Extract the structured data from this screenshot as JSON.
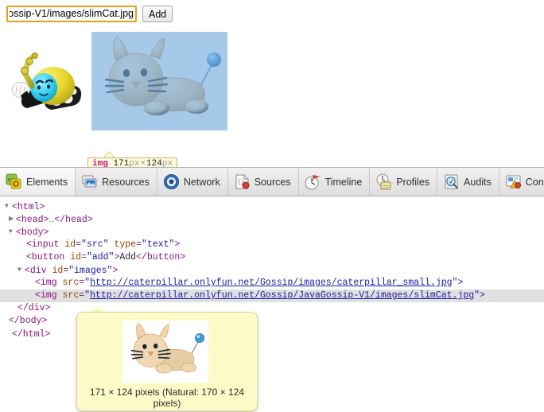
{
  "page": {
    "input": {
      "value": "http://caterpillar.onlyfun.net/Gossip/JavaGossip-V1/images/slimCat.jpg",
      "visible_value": "ip-V1/images/slimCat.jpg",
      "placeholder": ""
    },
    "add_button_label": "Add",
    "images": [
      {
        "name": "caterpillar-robot-image",
        "alt": "caterpillar_small.jpg"
      },
      {
        "name": "slim-cat-image",
        "alt": "slimCat.jpg"
      }
    ],
    "size_badge": {
      "tag": "img",
      "width": "171",
      "height": "124",
      "unit": "px",
      "times": "×"
    }
  },
  "devtools": {
    "tabs": [
      {
        "label": "Elements",
        "icon": "elements-icon",
        "active": true
      },
      {
        "label": "Resources",
        "icon": "resources-icon",
        "active": false
      },
      {
        "label": "Network",
        "icon": "network-icon",
        "active": false
      },
      {
        "label": "Sources",
        "icon": "sources-icon",
        "active": false
      },
      {
        "label": "Timeline",
        "icon": "timeline-icon",
        "active": false
      },
      {
        "label": "Profiles",
        "icon": "profiles-icon",
        "active": false
      },
      {
        "label": "Audits",
        "icon": "audits-icon",
        "active": false
      },
      {
        "label": "Console",
        "icon": "console-icon",
        "active": false
      }
    ],
    "dom": {
      "r1": {
        "tag_open": "<html>"
      },
      "r2": {
        "tag_open": "<head>",
        "ellipsis": "…",
        "tag_close": "</head>"
      },
      "r3": {
        "tag_open": "<body>"
      },
      "r4": {
        "lt": "<",
        "tag": "input",
        "attr1": "id",
        "val1": "\"src\"",
        "attr2": "type",
        "val2": "\"text\"",
        "gt": ">"
      },
      "r5": {
        "lt": "<",
        "tag": "button",
        "attr1": "id",
        "val1": "\"add\"",
        "gt": ">",
        "text": "Add",
        "close": "</button>"
      },
      "r6": {
        "lt": "<",
        "tag": "div",
        "attr1": "id",
        "val1": "\"images\"",
        "gt": ">"
      },
      "r7": {
        "lt": "<",
        "tag": "img",
        "attr1": "src",
        "quote": "\"",
        "url": "http://caterpillar.onlyfun.net/Gossip/images/caterpillar_small.jpg",
        "tail": "\">"
      },
      "r8": {
        "lt": "<",
        "tag": "img",
        "attr1": "src",
        "quote": "\"",
        "url": "http://caterpillar.onlyfun.net/Gossip/JavaGossip-V1/images/slimCat.jpg",
        "tail": "\">"
      },
      "r9": {
        "tag_close": "</div>"
      },
      "r10": {
        "tag_close": "</body>"
      },
      "r11": {
        "tag_close": "</html>"
      }
    },
    "preview": {
      "caption": "171 × 124 pixels (Natural: 170 × 124 pixels)"
    }
  },
  "colors": {
    "highlight_blue": "#6fa8dc",
    "selection_gray": "#e0e0e0",
    "tooltip_yellow": "#fdfbc8",
    "badge_yellow": "#fdfcd9",
    "focus_gold": "#e3a21a",
    "tag_purple": "#881280",
    "attr_brown": "#994500",
    "value_blue": "#1a1aa6"
  }
}
